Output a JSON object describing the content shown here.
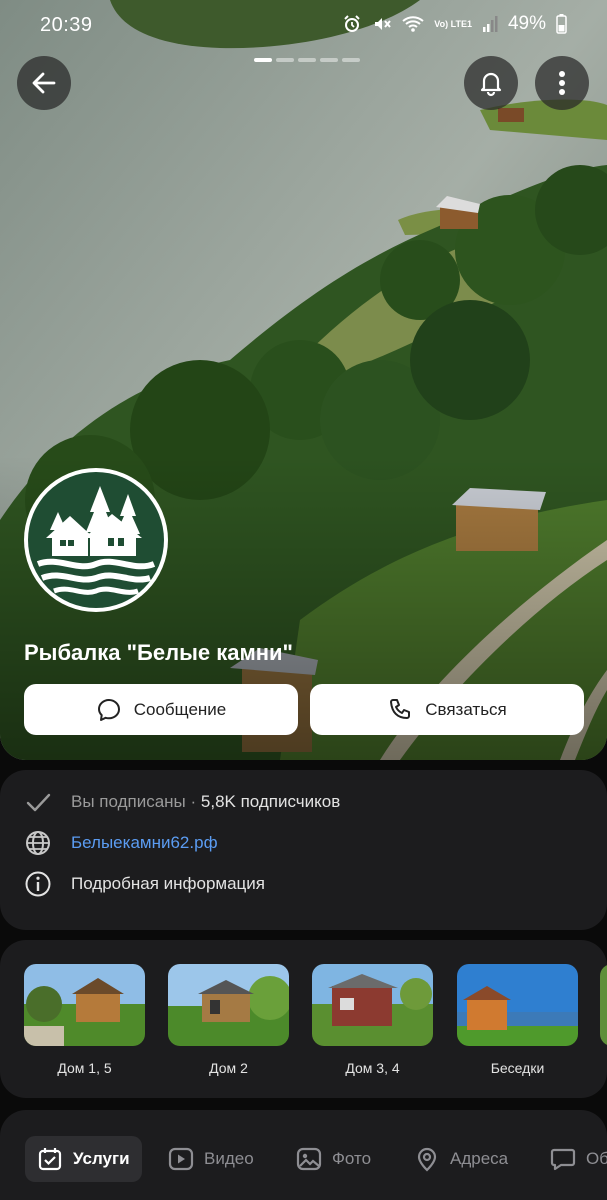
{
  "status_bar": {
    "time": "20:39",
    "network": "Vo) LTE1",
    "battery": "49%"
  },
  "page": {
    "title": "Рыбалка \"Белые камни\"",
    "message_label": "Сообщение",
    "contact_label": "Связаться"
  },
  "info": {
    "subscribed": "Вы подписаны",
    "separator": "·",
    "subscribers": "5,8K подписчиков",
    "website": "Белыекамни62.рф",
    "details": "Подробная информация"
  },
  "albums": [
    {
      "label": "Дом 1, 5"
    },
    {
      "label": "Дом 2"
    },
    {
      "label": "Дом 3, 4"
    },
    {
      "label": "Беседки"
    }
  ],
  "tabs": [
    {
      "label": "Услуги",
      "icon": "calendar-check-icon",
      "active": true
    },
    {
      "label": "Видео",
      "icon": "play-icon"
    },
    {
      "label": "Фото",
      "icon": "image-icon"
    },
    {
      "label": "Адреса",
      "icon": "location-pin-icon"
    },
    {
      "label": "Об",
      "icon": "chat-bubble-icon"
    }
  ],
  "colors": {
    "accent_link": "#5b9cf2",
    "logo_green": "#1f4d33",
    "panel": "#1c1c1e"
  }
}
